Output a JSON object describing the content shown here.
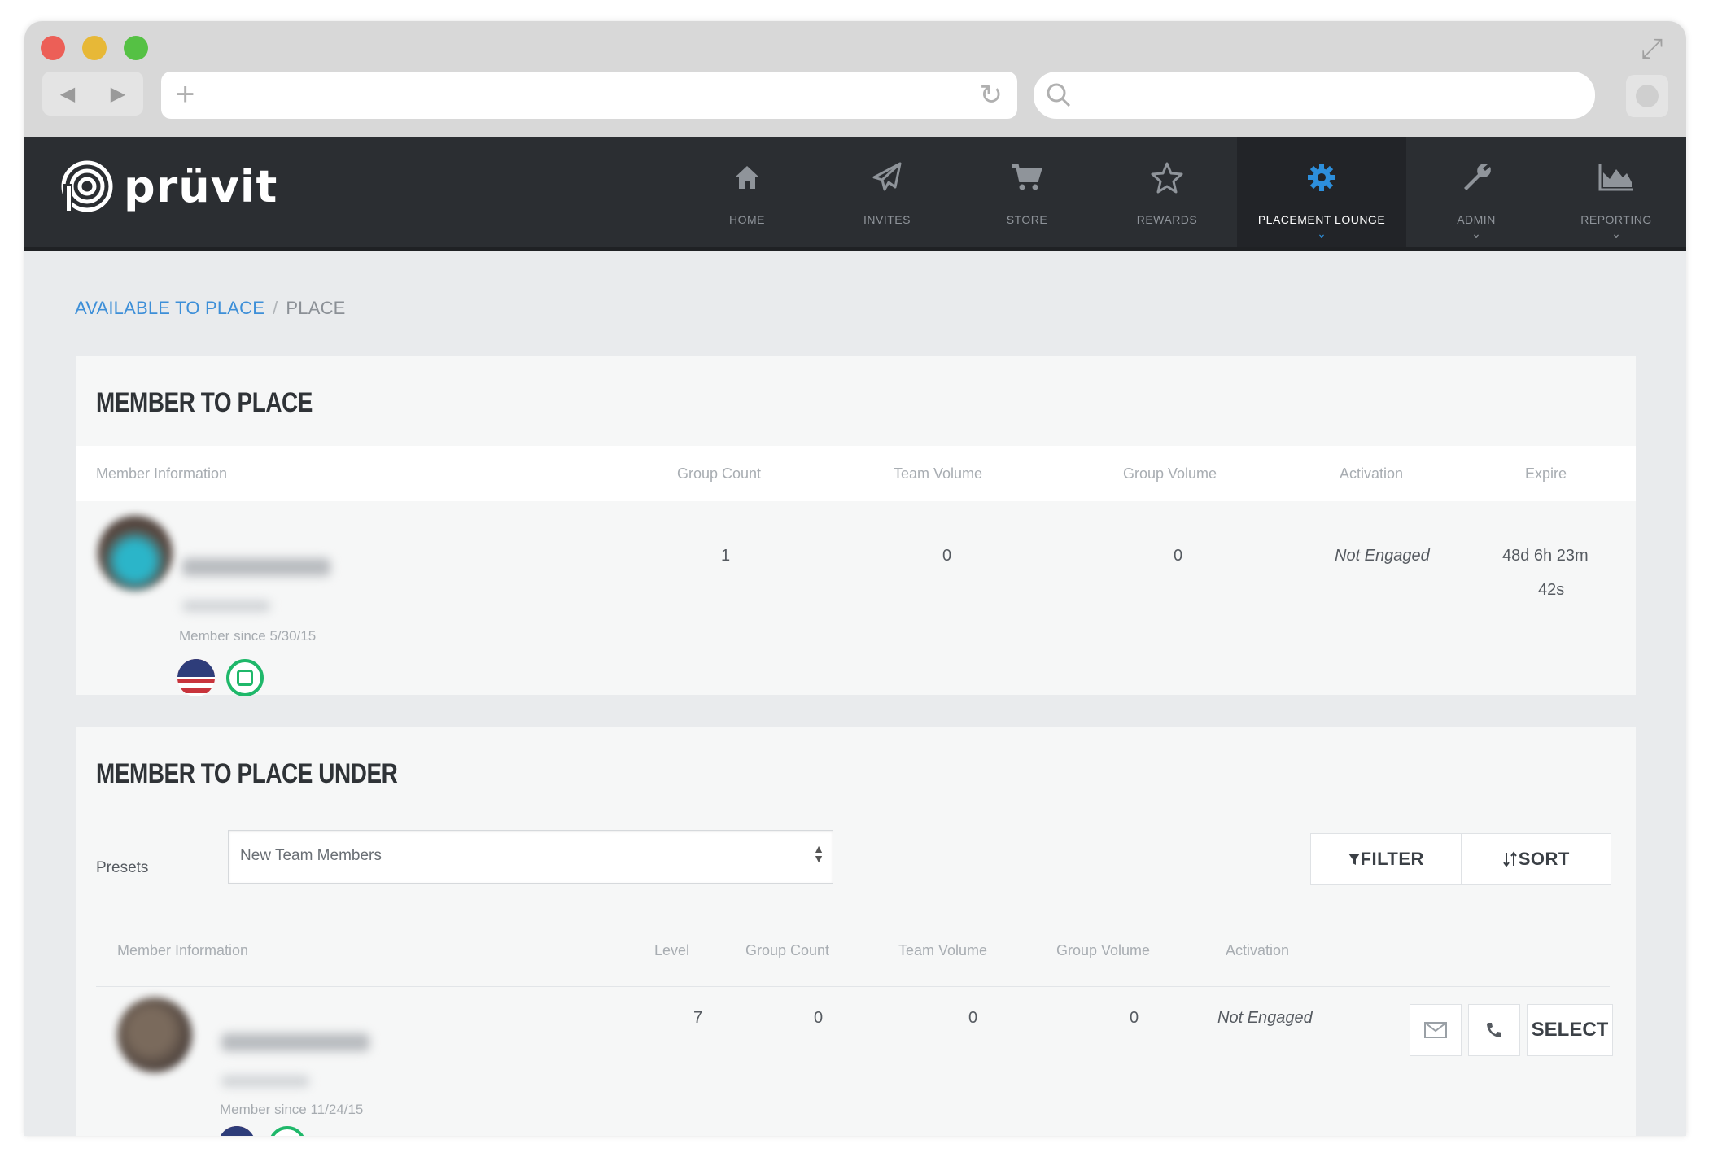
{
  "app": {
    "logo_text": "prüvit",
    "nav": [
      {
        "label": "HOME",
        "icon": "home-icon"
      },
      {
        "label": "INVITES",
        "icon": "paper-plane-icon"
      },
      {
        "label": "STORE",
        "icon": "cart-icon"
      },
      {
        "label": "REWARDS",
        "icon": "star-icon"
      },
      {
        "label": "PLACEMENT LOUNGE",
        "icon": "gear-icon",
        "active": true
      },
      {
        "label": "ADMIN",
        "icon": "wrench-icon"
      },
      {
        "label": "REPORTING",
        "icon": "area-chart-icon"
      }
    ],
    "accent_color": "#3d8fd8"
  },
  "breadcrumb": {
    "link": "AVAILABLE TO PLACE",
    "separator": "/",
    "current": "PLACE"
  },
  "member_to_place": {
    "title": "MEMBER TO PLACE",
    "columns": [
      "Member Information",
      "Group Count",
      "Team Volume",
      "Group Volume",
      "Activation",
      "Expire"
    ],
    "row": {
      "member_since": "Member since 5/30/15",
      "group_count": "1",
      "team_volume": "0",
      "group_volume": "0",
      "activation": "Not Engaged",
      "expire_line1": "48d 6h 23m",
      "expire_line2": "42s"
    }
  },
  "member_to_place_under": {
    "title": "MEMBER TO PLACE UNDER",
    "presets_label": "Presets",
    "presets_value": "New Team Members",
    "filter_label": "FILTER",
    "sort_label": "SORT",
    "columns": [
      "Member Information",
      "Level",
      "Group Count",
      "Team Volume",
      "Group Volume",
      "Activation"
    ],
    "row": {
      "member_since": "Member since 11/24/15",
      "level": "7",
      "group_count": "0",
      "team_volume": "0",
      "group_volume": "0",
      "activation": "Not Engaged",
      "select_label": "SELECT"
    }
  }
}
